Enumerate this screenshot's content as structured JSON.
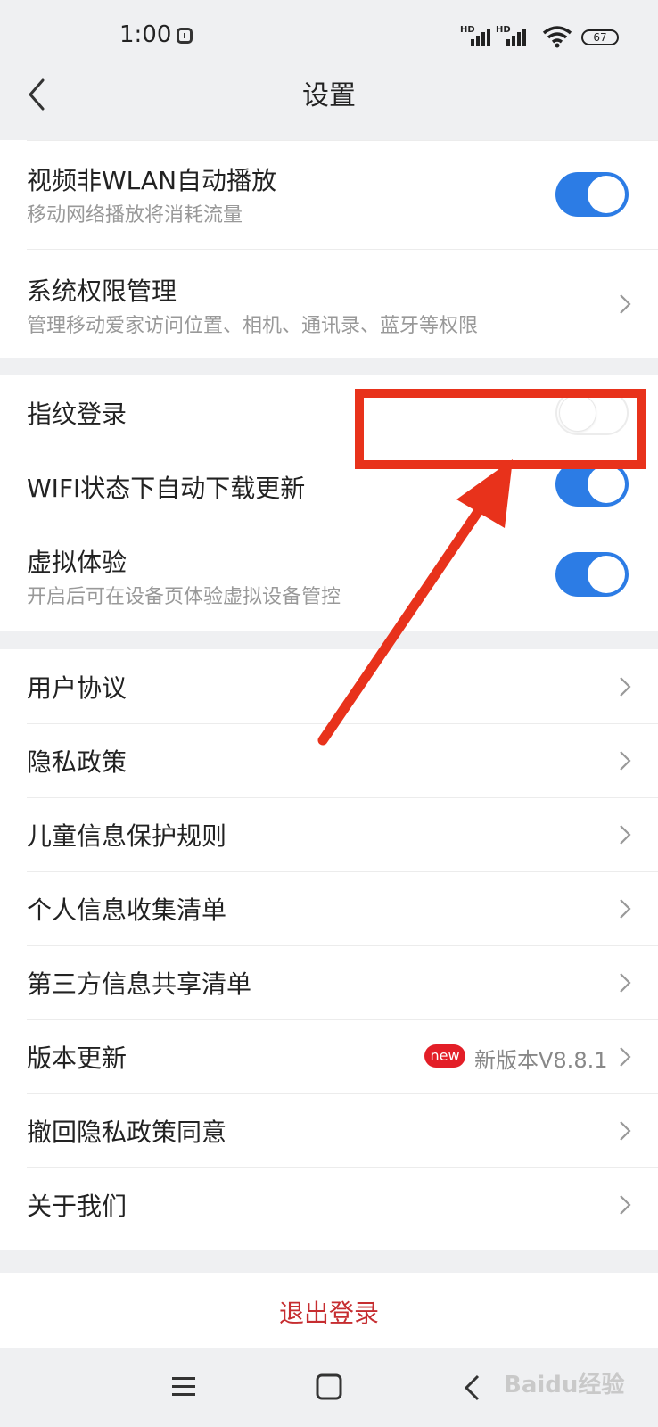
{
  "status_bar": {
    "time": "1:00",
    "signal1_label": "HD",
    "signal2_label": "HD",
    "battery": "67"
  },
  "header": {
    "title": "设置"
  },
  "section1": {
    "video_autoplay": {
      "label": "视频非WLAN自动播放",
      "sub": "移动网络播放将消耗流量",
      "enabled": true
    },
    "permissions": {
      "label": "系统权限管理",
      "sub": "管理移动爱家访问位置、相机、通讯录、蓝牙等权限"
    }
  },
  "section2": {
    "fingerprint": {
      "label": "指纹登录",
      "enabled": false
    },
    "wifi_update": {
      "label": "WIFI状态下自动下载更新",
      "enabled": true
    },
    "virtual": {
      "label": "虚拟体验",
      "sub": "开启后可在设备页体验虚拟设备管控",
      "enabled": true
    }
  },
  "section3": {
    "items": [
      {
        "label": "用户协议"
      },
      {
        "label": "隐私政策"
      },
      {
        "label": "儿童信息保护规则"
      },
      {
        "label": "个人信息收集清单"
      },
      {
        "label": "第三方信息共享清单"
      },
      {
        "label": "版本更新",
        "badge": "new",
        "value": "新版本V8.8.1"
      },
      {
        "label": "撤回隐私政策同意"
      },
      {
        "label": "关于我们"
      }
    ]
  },
  "logout": {
    "label": "退出登录"
  },
  "watermark": "Baidu经验",
  "colors": {
    "accent": "#2c7ce5",
    "logout": "#c62d30",
    "highlight": "#e8321b",
    "badge": "#e31e27"
  }
}
